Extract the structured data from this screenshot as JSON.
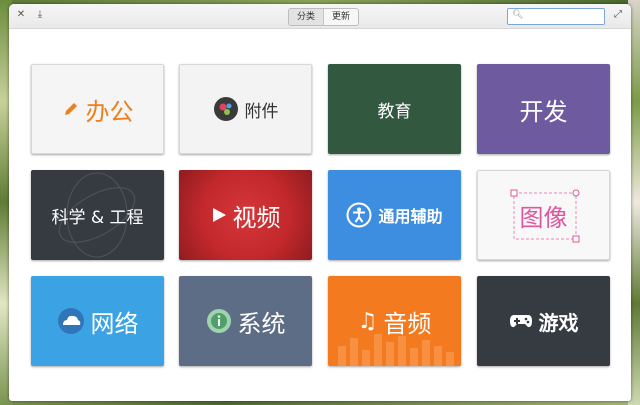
{
  "toolbar": {
    "view_tabs": [
      "分类",
      "更新"
    ],
    "search_placeholder": ""
  },
  "categories": [
    {
      "label": "办公",
      "icon": "pencil-icon",
      "bg": "#f5f5f5",
      "fg": "#ef7f1a"
    },
    {
      "label": "附件",
      "icon": "accessories-icon",
      "bg": "#f3f3f3",
      "fg": "#333333"
    },
    {
      "label": "教育",
      "icon": "",
      "bg": "#32593f",
      "fg": "#ffffff"
    },
    {
      "label": "开发",
      "icon": "",
      "bg": "#6e5a9e",
      "fg": "#ffffff"
    },
    {
      "label": "科学 & 工程",
      "icon": "",
      "bg": "#363b41",
      "fg": "#ffffff"
    },
    {
      "label": "视频",
      "icon": "play-icon",
      "bg": "#c2282c",
      "fg": "#ffffff"
    },
    {
      "label": "通用辅助",
      "icon": "accessibility-icon",
      "bg": "#3d8ee0",
      "fg": "#ffffff"
    },
    {
      "label": "图像",
      "icon": "",
      "bg": "#f8f8f8",
      "fg": "#e0559c"
    },
    {
      "label": "网络",
      "icon": "cloud-icon",
      "bg": "#3ba3e4",
      "fg": "#ffffff"
    },
    {
      "label": "系统",
      "icon": "info-icon",
      "bg": "#5e6d86",
      "fg": "#ffffff"
    },
    {
      "label": "音频",
      "icon": "music-note-icon",
      "bg": "#f47a20",
      "fg": "#ffffff"
    },
    {
      "label": "游戏",
      "icon": "gamepad-icon",
      "bg": "#363b41",
      "fg": "#ffffff"
    }
  ]
}
